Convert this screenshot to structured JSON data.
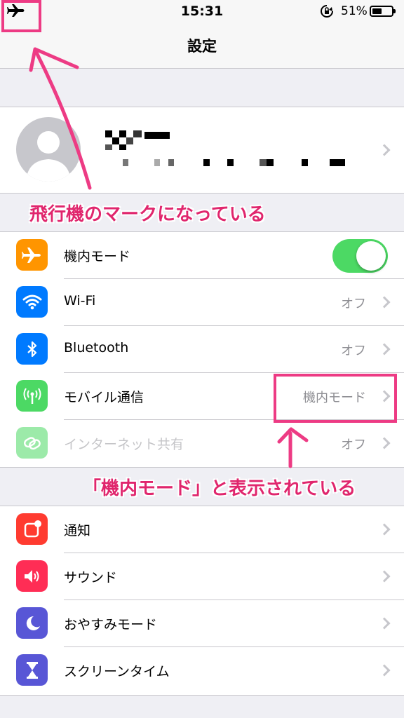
{
  "status_bar": {
    "time": "15:31",
    "battery_percent_text": "51%",
    "battery_level": 0.51,
    "icons": [
      "airplane-icon",
      "rotation-lock-icon",
      "battery-icon"
    ]
  },
  "nav": {
    "title": "設定"
  },
  "profile": {
    "masked": true
  },
  "annotations": {
    "top": "飛行機のマークになっている",
    "middle": "「機内モード」と表示されている",
    "color": "#e0266d"
  },
  "connectivity": {
    "airplane": {
      "label": "機内モード",
      "toggle_on": true,
      "icon": "airplane-icon",
      "color": "#ff9500"
    },
    "wifi": {
      "label": "Wi-Fi",
      "value": "オフ",
      "icon": "wifi-icon",
      "color": "#007aff"
    },
    "bluetooth": {
      "label": "Bluetooth",
      "value": "オフ",
      "icon": "bluetooth-icon",
      "color": "#007aff"
    },
    "cellular": {
      "label": "モバイル通信",
      "value": "機内モード",
      "icon": "cellular-icon",
      "color": "#4cd964"
    },
    "hotspot": {
      "label": "インターネット共有",
      "value": "オフ",
      "icon": "hotspot-icon",
      "color": "#4cd964"
    }
  },
  "notifications_group": {
    "notifications": {
      "label": "通知",
      "icon": "notifications-icon",
      "color": "#ff3b30"
    },
    "sounds": {
      "label": "サウンド",
      "icon": "speaker-icon",
      "color": "#ff2d55"
    },
    "dnd": {
      "label": "おやすみモード",
      "icon": "moon-icon",
      "color": "#5856d6"
    },
    "screentime": {
      "label": "スクリーンタイム",
      "icon": "hourglass-icon",
      "color": "#5856d6"
    }
  }
}
